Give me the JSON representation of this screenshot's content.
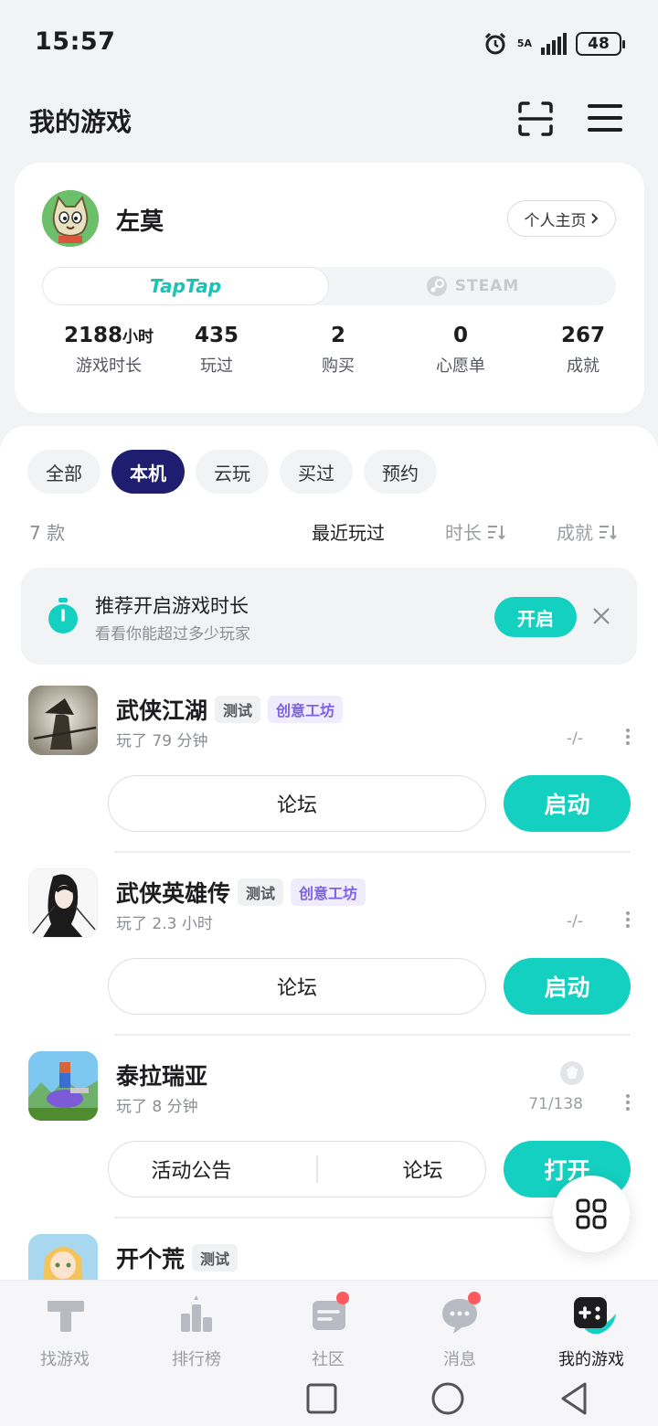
{
  "status_bar": {
    "time": "15:57",
    "network": "5A",
    "battery": "48"
  },
  "header": {
    "title": "我的游戏"
  },
  "profile": {
    "username": "左莫",
    "homepage_label": "个人主页",
    "platforms": {
      "taptap": "TapTap",
      "steam": "STEAM"
    },
    "stats": [
      {
        "value": "2188",
        "unit": "小时",
        "label": "游戏时长"
      },
      {
        "value": "435",
        "unit": "",
        "label": "玩过"
      },
      {
        "value": "2",
        "unit": "",
        "label": "购买"
      },
      {
        "value": "0",
        "unit": "",
        "label": "心愿单"
      },
      {
        "value": "267",
        "unit": "",
        "label": "成就"
      }
    ]
  },
  "filters": {
    "chips": [
      "全部",
      "本机",
      "云玩",
      "买过",
      "预约"
    ],
    "active": "本机",
    "count_label": "7 款",
    "sort": {
      "recent": "最近玩过",
      "duration": "时长",
      "achievement": "成就"
    }
  },
  "tip": {
    "title": "推荐开启游戏时长",
    "subtitle": "看看你能超过多少玩家",
    "enable_label": "开启"
  },
  "games": [
    {
      "name": "武侠江湖",
      "tags": [
        "测试",
        "创意工坊"
      ],
      "playtime": "玩了 79 分钟",
      "achievements": "-/-",
      "buttons": [
        "论坛"
      ],
      "primary": "启动"
    },
    {
      "name": "武侠英雄传",
      "tags": [
        "测试",
        "创意工坊"
      ],
      "playtime": "玩了 2.3 小时",
      "achievements": "-/-",
      "buttons": [
        "论坛"
      ],
      "primary": "启动"
    },
    {
      "name": "泰拉瑞亚",
      "tags": [],
      "playtime": "玩了 8 分钟",
      "achievements": "71/138",
      "buttons": [
        "活动公告",
        "论坛"
      ],
      "primary": "打开"
    },
    {
      "name": "开个荒",
      "tags": [
        "测试"
      ],
      "playtime": "",
      "achievements": "",
      "buttons": [],
      "primary": ""
    }
  ],
  "bottom_nav": [
    {
      "label": "找游戏",
      "icon": "taptap-logo-icon",
      "badge": false
    },
    {
      "label": "排行榜",
      "icon": "ranking-icon",
      "badge": false
    },
    {
      "label": "社区",
      "icon": "community-icon",
      "badge": true
    },
    {
      "label": "消息",
      "icon": "message-icon",
      "badge": true
    },
    {
      "label": "我的游戏",
      "icon": "my-games-icon",
      "badge": false,
      "active": true
    }
  ],
  "colors": {
    "accent": "#14d0c0",
    "chip_active": "#1e1d6f",
    "workshop_tag": "#7e5fe8",
    "badge": "#ff5a5f"
  }
}
